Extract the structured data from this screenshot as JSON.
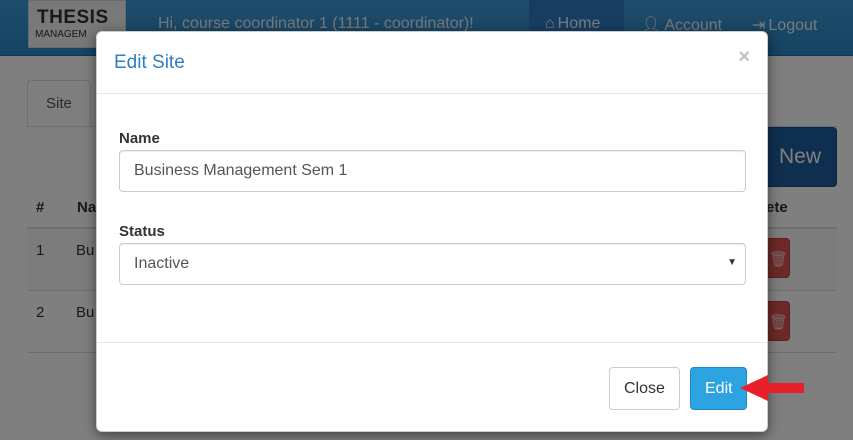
{
  "navbar": {
    "logo_line1": "THESIS",
    "logo_line2": "MANAGEM",
    "greeting": "Hi, course coordinator 1 (1111 - coordinator)!",
    "home_label": "Home",
    "account_label": "Account",
    "logout_label": "Logout"
  },
  "page": {
    "tab_label": "Site",
    "add_new_label": "New",
    "table_headers": [
      "#",
      "Na",
      "ete"
    ],
    "rows": [
      {
        "num": "1",
        "name": "Bu"
      },
      {
        "num": "2",
        "name": "Bu"
      }
    ]
  },
  "modal": {
    "title": "Edit Site",
    "close_symbol": "×",
    "name_label": "Name",
    "name_value": "Business Management Sem 1",
    "status_label": "Status",
    "status_value": "Inactive",
    "close_button": "Close",
    "edit_button": "Edit"
  },
  "colors": {
    "navbar": "#2a86c5",
    "primary_title": "#2f80c2",
    "edit_button": "#2ea3e2",
    "delete_button": "#d9534f",
    "annotation_arrow": "#e8202a"
  }
}
